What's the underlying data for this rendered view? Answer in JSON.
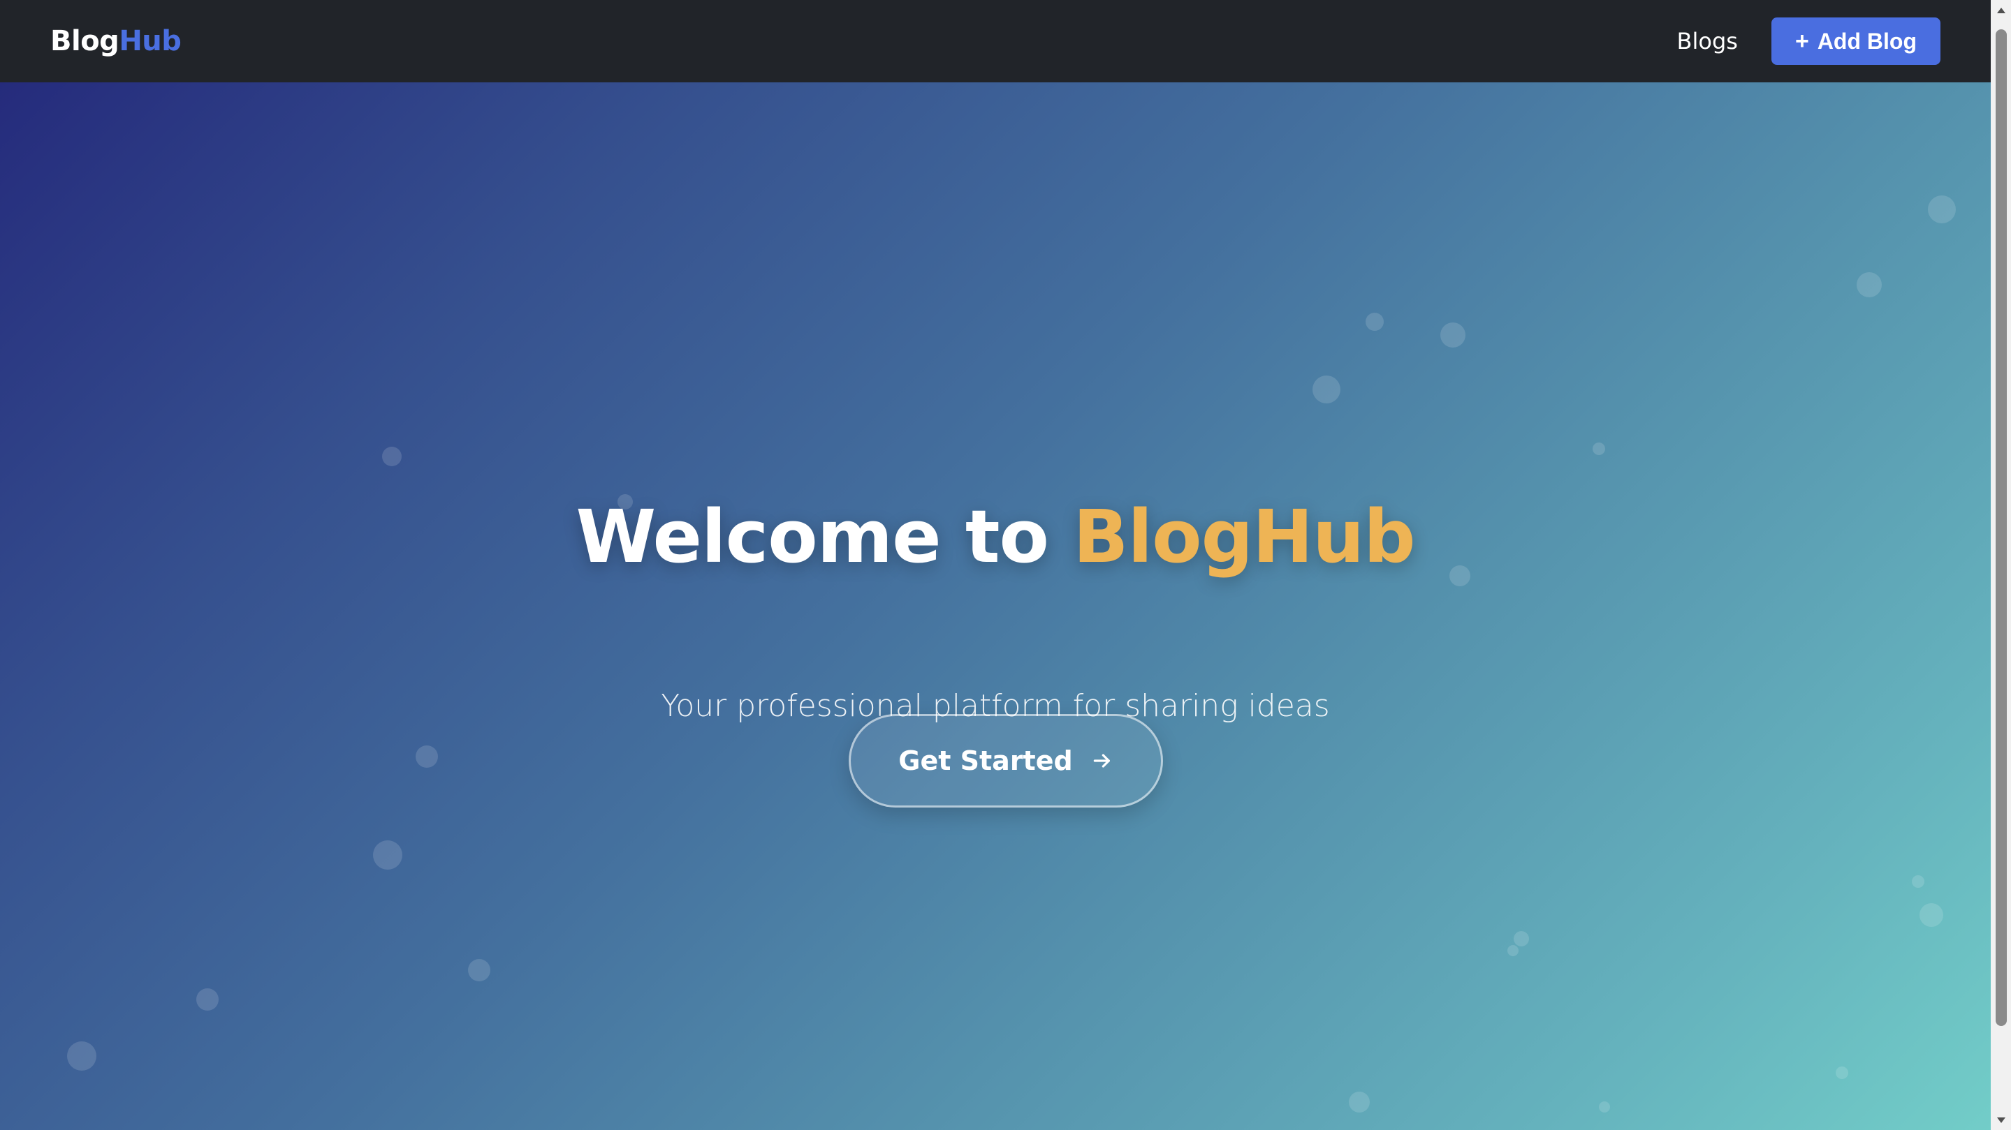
{
  "navbar": {
    "brand_part1": "Blog",
    "brand_part2": "Hub",
    "nav_link": "Blogs",
    "add_button_icon": "plus-icon",
    "add_button_label": "Add Blog",
    "add_button_plus": "+"
  },
  "hero": {
    "title_prefix": "Welcome to ",
    "title_highlight": "BlogHub",
    "subtitle": "Your professional platform for sharing ideas",
    "cta_label": "Get Started",
    "cta_icon": "arrow-right-icon"
  },
  "colors": {
    "navbar_bg": "#212429",
    "brand_accent": "#4a6fe0",
    "button_primary": "#4a6ee0",
    "title_highlight": "#eeb455",
    "gradient_start": "#252b7c",
    "gradient_end": "#72cdc8"
  },
  "scrollbar": {
    "up_icon": "scroll-up-arrow-icon",
    "down_icon": "scroll-down-arrow-icon"
  }
}
